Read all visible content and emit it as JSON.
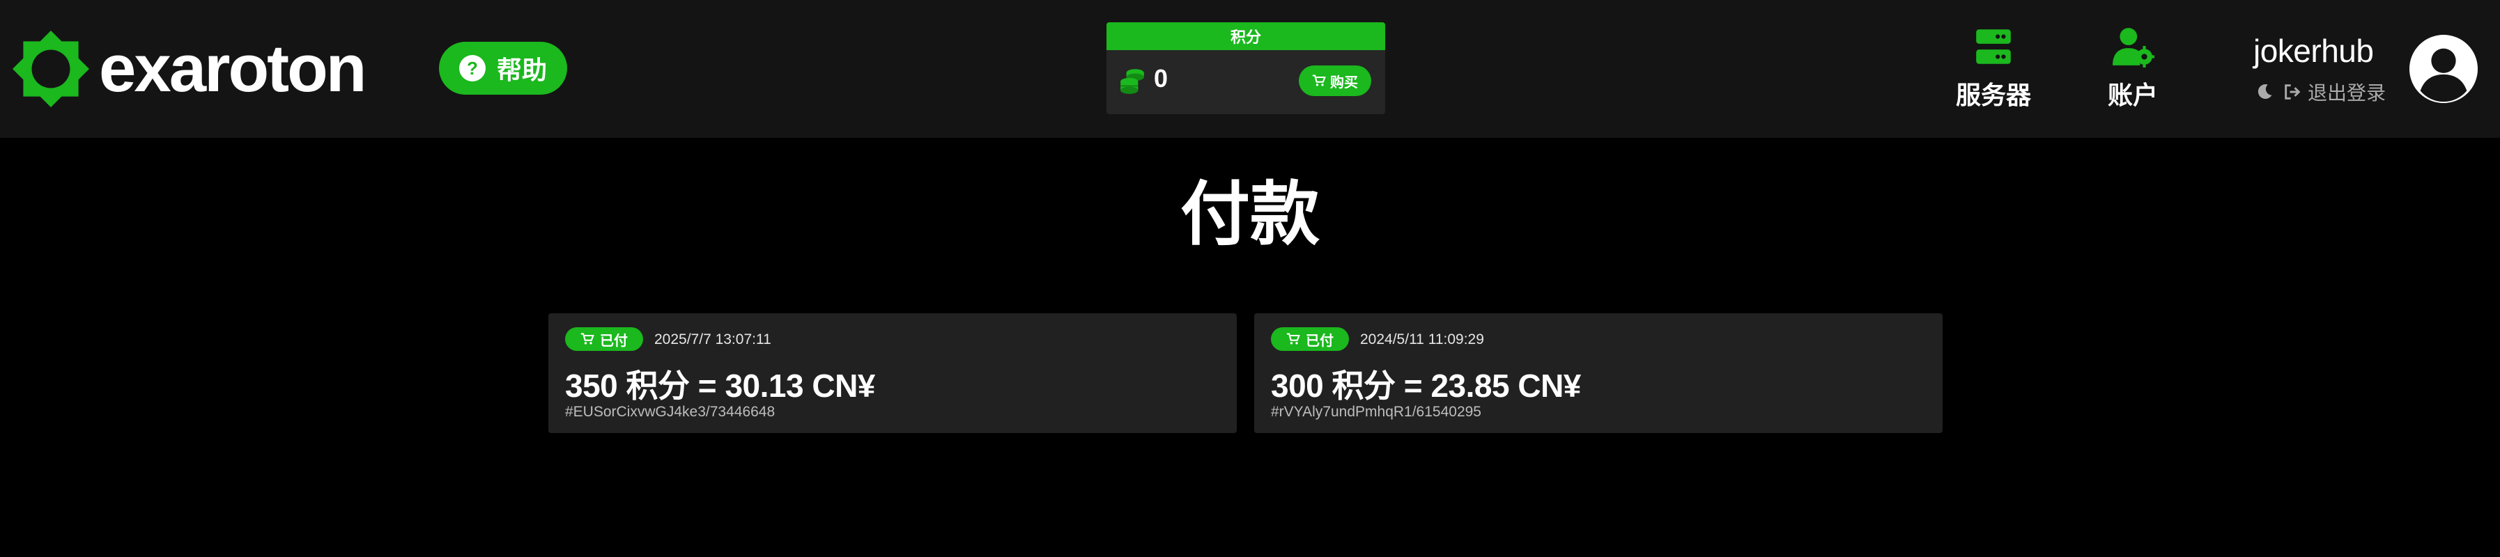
{
  "brand": {
    "name": "exaroton",
    "logo_icon": "exaroton-gear-logo",
    "accent_color": "#1bb81e"
  },
  "header": {
    "help": {
      "icon": "question-circle-icon",
      "label": "帮助"
    },
    "credits": {
      "title": "积分",
      "icon": "coins-icon",
      "amount": "0",
      "buy_label": "购买",
      "buy_icon": "cart-icon"
    },
    "nav": [
      {
        "icon": "server-icon",
        "label": "服务器"
      },
      {
        "icon": "user-gear-icon",
        "label": "账户"
      }
    ],
    "user": {
      "name": "jokerhub",
      "theme_icon": "moon-icon",
      "logout_icon": "sign-out-icon",
      "logout_label": "退出登录",
      "avatar_icon": "user-circle-icon"
    }
  },
  "page": {
    "title": "付款"
  },
  "payments": [
    {
      "status": "已付",
      "status_icon": "cart-icon",
      "date": "2025/7/7 13:07:11",
      "amount": "350 积分 = 30.13 CN¥",
      "reference": "#EUSorCixvwGJ4ke3/73446648"
    },
    {
      "status": "已付",
      "status_icon": "cart-icon",
      "date": "2024/5/11 11:09:29",
      "amount": "300 积分 = 23.85 CN¥",
      "reference": "#rVYAly7undPmhqR1/61540295"
    }
  ]
}
